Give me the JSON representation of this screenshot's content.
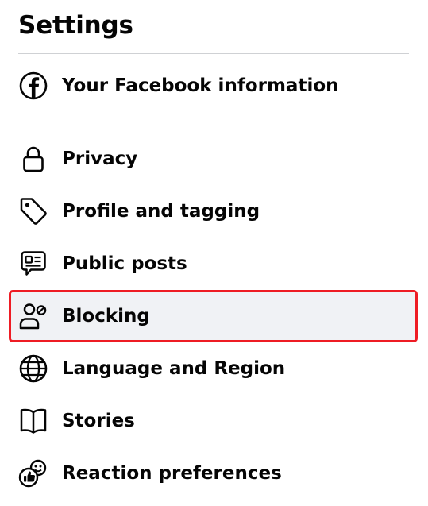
{
  "header": {
    "title": "Settings"
  },
  "colors": {
    "highlight_border": "#ee1c24",
    "selected_bg": "#f0f2f5",
    "text": "#050505"
  },
  "sections": {
    "account": {
      "items": [
        {
          "label": "Your Facebook information",
          "icon": "facebook-icon"
        }
      ]
    },
    "settings_list": {
      "items": [
        {
          "label": "Privacy",
          "icon": "lock-icon"
        },
        {
          "label": "Profile and tagging",
          "icon": "tag-icon"
        },
        {
          "label": "Public posts",
          "icon": "public-posts-icon"
        },
        {
          "label": "Blocking",
          "icon": "blocking-icon",
          "selected": true
        },
        {
          "label": "Language and Region",
          "icon": "globe-icon"
        },
        {
          "label": "Stories",
          "icon": "book-icon"
        },
        {
          "label": "Reaction preferences",
          "icon": "reaction-icon"
        }
      ]
    }
  }
}
